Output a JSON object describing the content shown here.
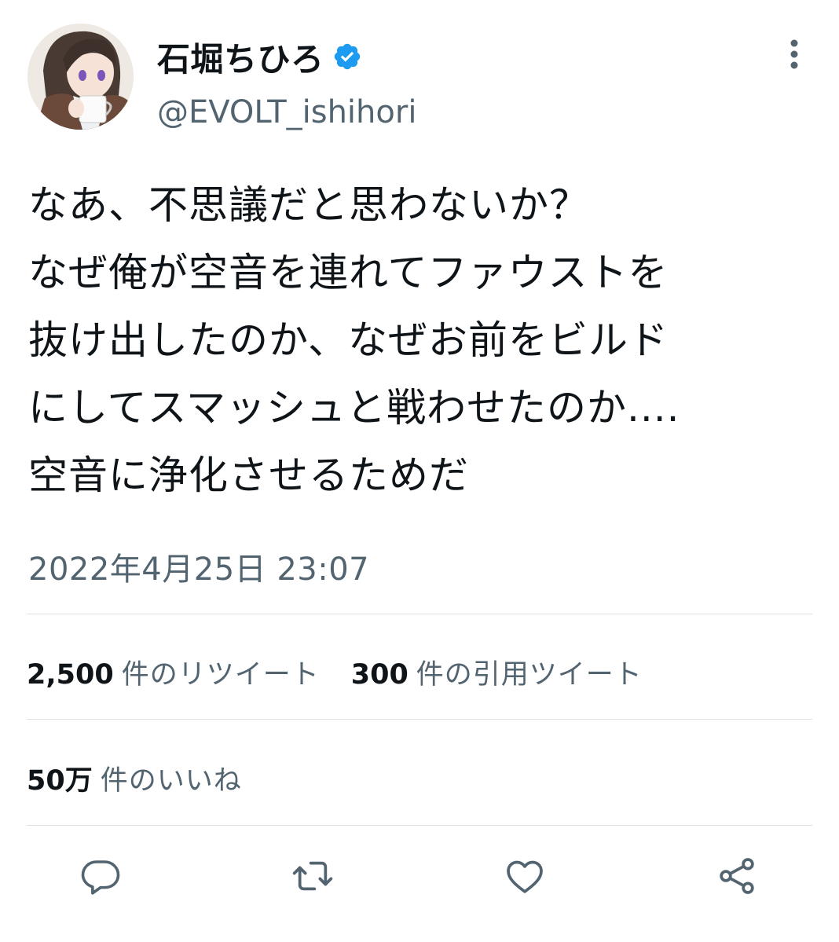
{
  "user": {
    "display_name": "石堀ちひろ",
    "handle": "@EVOLT_ishihori",
    "verified": true,
    "avatar": "anime-character-avatar"
  },
  "tweet": {
    "text": "なあ、不思議だと思わないか？\nなぜ俺が空音を連れてファウストを\n抜け出したのか、なぜお前をビルド\nにしてスマッシュと戦わせたのか....\n空音に浄化させるためだ",
    "timestamp": "2022年4月25日 23:07"
  },
  "stats": {
    "retweets_count": "2,500",
    "retweets_label": "件のリツイート",
    "quotes_count": "300",
    "quotes_label": "件の引用ツイート",
    "likes_count": "50万",
    "likes_label": "件のいいね"
  },
  "actions": [
    {
      "icon": "reply-icon"
    },
    {
      "icon": "retweet-icon"
    },
    {
      "icon": "like-icon"
    },
    {
      "icon": "share-icon"
    }
  ],
  "colors": {
    "text": "#0f1419",
    "secondary": "#536471",
    "verified": "#1d9bf0",
    "divider": "#dbe1e6"
  }
}
